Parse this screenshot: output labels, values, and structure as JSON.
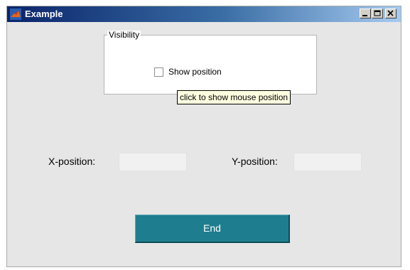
{
  "window": {
    "title": "Example",
    "app_icon": "matlab-icon",
    "controls": [
      "minimize-icon",
      "maximize-icon",
      "close-icon"
    ]
  },
  "visibility_panel": {
    "title": "Visibility",
    "checkbox_label": "Show position",
    "checkbox_checked": false,
    "tooltip": "click to show mouse position"
  },
  "position": {
    "x_label": "X-position:",
    "x_value": "",
    "y_label": "Y-position:",
    "y_value": ""
  },
  "end_button": {
    "label": "End"
  },
  "colors": {
    "titlebar_start": "#0a246a",
    "titlebar_end": "#a6caf0",
    "window_bg": "#e6e6e6",
    "end_button_bg": "#1e7e8f",
    "tooltip_bg": "#ffffe1"
  }
}
